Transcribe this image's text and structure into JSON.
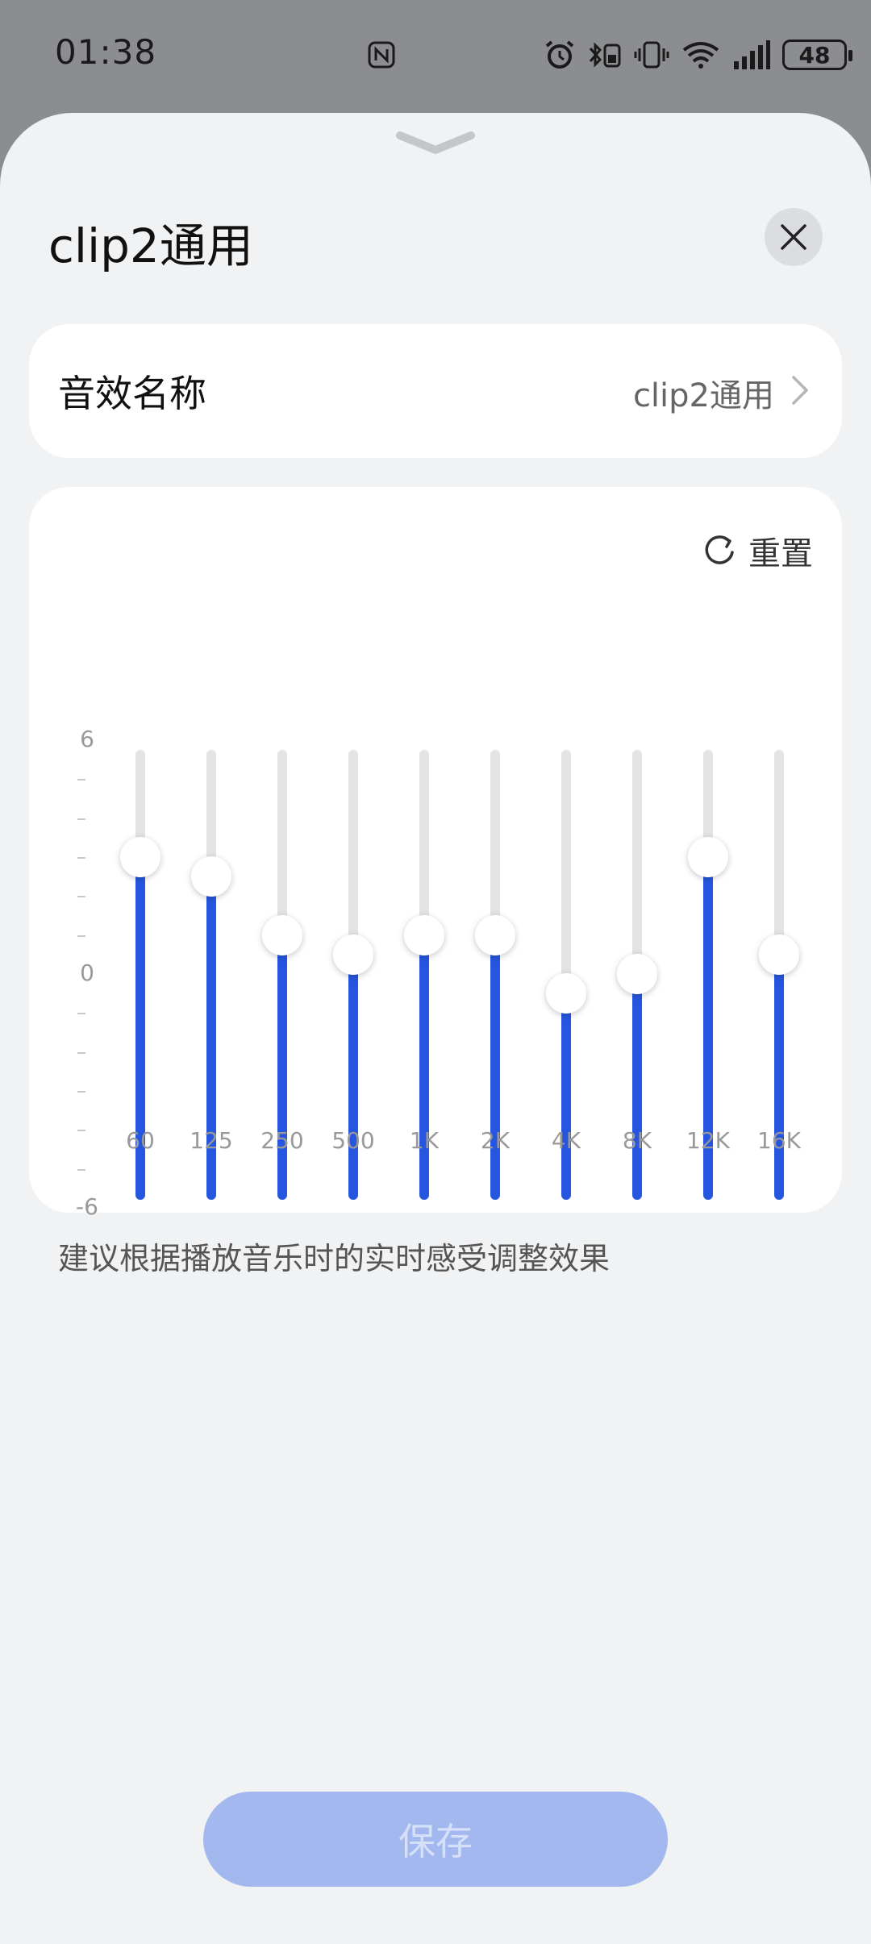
{
  "status_bar": {
    "time": "01:38",
    "battery": "48",
    "icons": [
      "nfc-icon",
      "alarm-icon",
      "bluetooth-icon",
      "vibrate-icon",
      "wifi-icon",
      "signal-icon"
    ]
  },
  "sheet": {
    "title": "clip2通用",
    "close_icon": "close-icon",
    "handle_icon": "chevron-down-icon"
  },
  "preset": {
    "label": "音效名称",
    "value": "clip2通用"
  },
  "eq": {
    "reset_label": "重置",
    "axis": {
      "max": "6",
      "zero": "0",
      "min": "-6",
      "range": [
        -6,
        6
      ]
    },
    "bands": [
      {
        "label": "60",
        "gain": 3.0
      },
      {
        "label": "125",
        "gain": 2.5
      },
      {
        "label": "250",
        "gain": 1.0
      },
      {
        "label": "500",
        "gain": 0.5
      },
      {
        "label": "1K",
        "gain": 1.0
      },
      {
        "label": "2K",
        "gain": 1.0
      },
      {
        "label": "4K",
        "gain": -0.5
      },
      {
        "label": "8K",
        "gain": 0.0
      },
      {
        "label": "12K",
        "gain": 3.0
      },
      {
        "label": "16K",
        "gain": 0.5
      }
    ],
    "fill_color": "#2655e0",
    "track_color": "#e3e3e3"
  },
  "hint": "建议根据播放音乐时的实时感受调整效果",
  "save_label": "保存",
  "colors": {
    "save_button": "#a2b8ef"
  }
}
